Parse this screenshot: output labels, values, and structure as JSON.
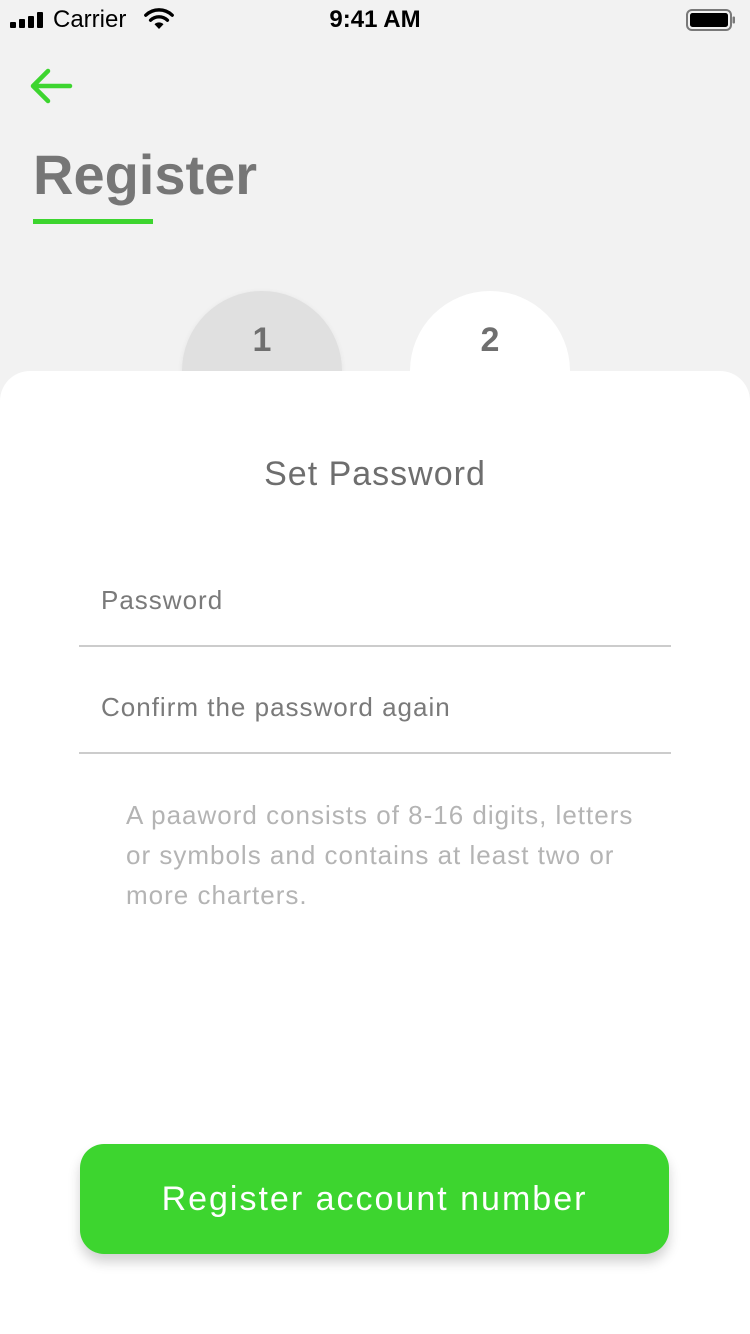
{
  "status_bar": {
    "carrier": "Carrier",
    "time": "9:41 AM",
    "icons": [
      "signal-icon",
      "wifi-icon",
      "battery-icon"
    ]
  },
  "header": {
    "back_icon": "arrow-left-icon",
    "title": "Register"
  },
  "steps": [
    {
      "label": "1",
      "active": false
    },
    {
      "label": "2",
      "active": true
    }
  ],
  "form": {
    "title": "Set Password",
    "password": {
      "value": "",
      "placeholder": "Password"
    },
    "confirm": {
      "value": "",
      "placeholder": "Confirm the password again"
    },
    "hint": "A paaword consists of 8-16 digits, letters or symbols and contains at least two or more charters.",
    "submit_label": "Register account number"
  },
  "colors": {
    "accent": "#3dd52f",
    "background": "#f2f2f2",
    "card": "#ffffff",
    "title_text": "#767676",
    "hint_text": "#b4b4b4"
  }
}
